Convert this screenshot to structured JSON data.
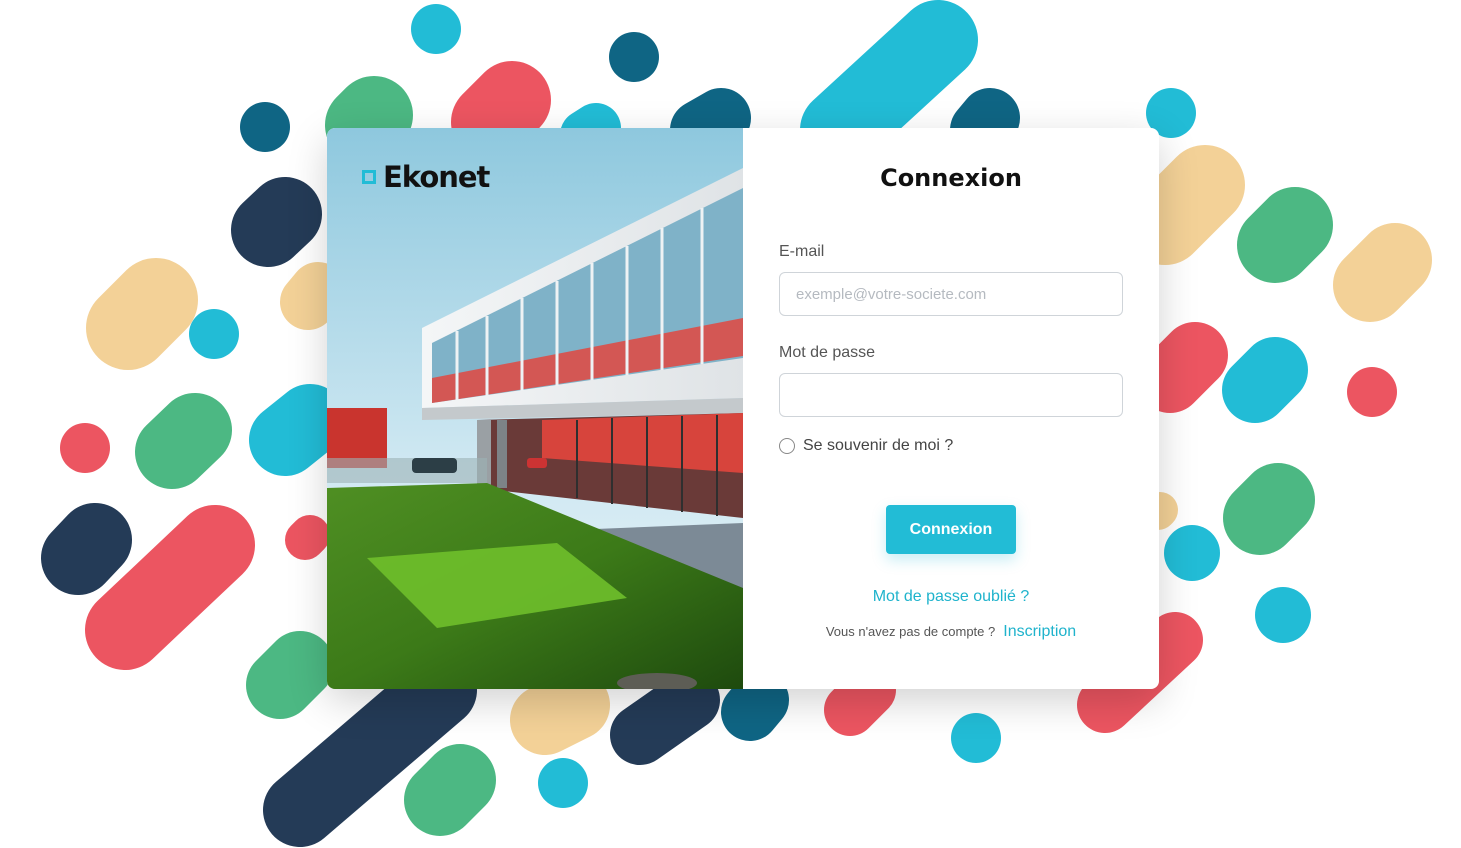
{
  "brand": {
    "name": "Ekonet",
    "accent_color": "#22bcd6"
  },
  "login": {
    "title": "Connexion",
    "email_label": "E-mail",
    "email_placeholder": "exemple@votre-societe.com",
    "email_value": "",
    "password_label": "Mot de passe",
    "password_value": "",
    "remember_label": "Se souvenir de moi ?",
    "remember_checked": false,
    "submit_label": "Connexion",
    "forgot_label": "Mot de passe oublié ?",
    "signup_prompt": "Vous n'avez pas de compte ?",
    "signup_label": "Inscription"
  },
  "theme": {
    "primary": "#22bcd6",
    "background_palette": [
      "#22bcd6",
      "#0f6584",
      "#243b57",
      "#4cb883",
      "#ec5561",
      "#f3d197"
    ]
  }
}
